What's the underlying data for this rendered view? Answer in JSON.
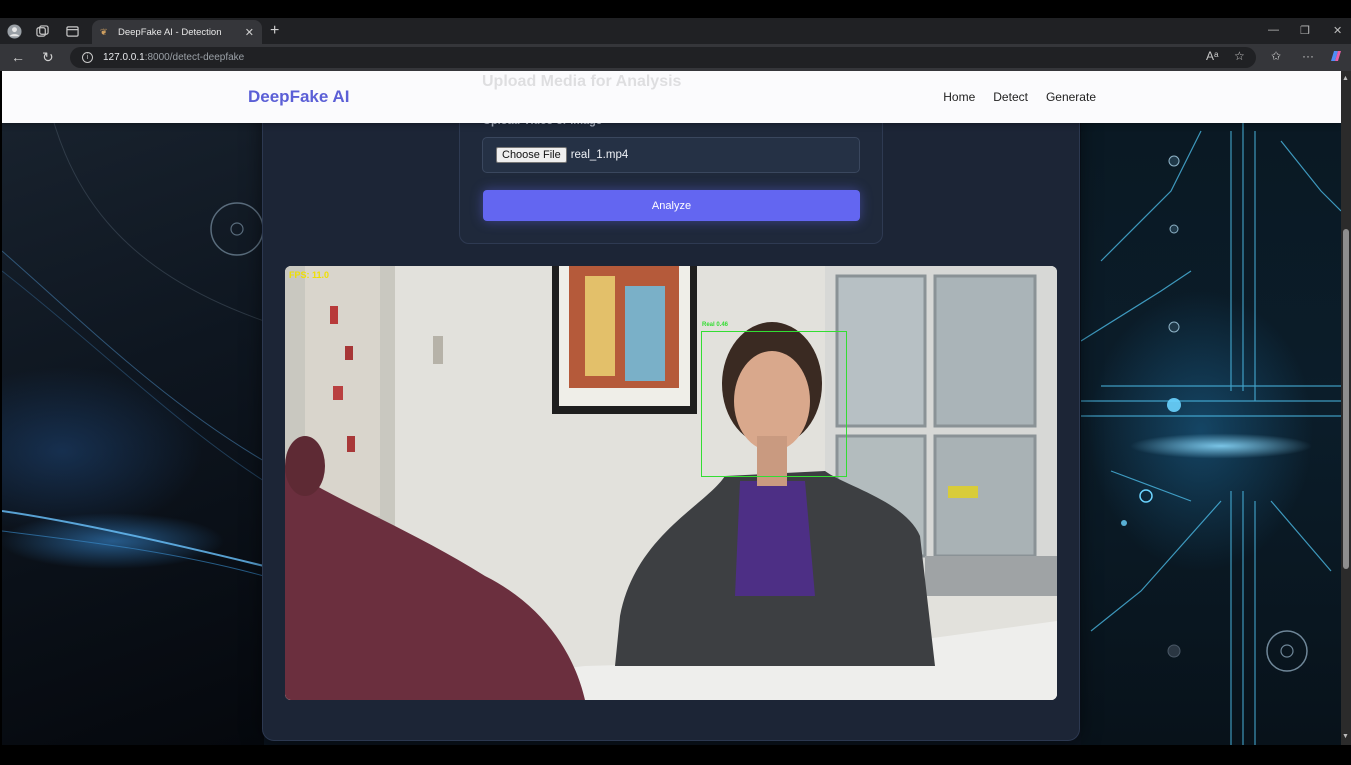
{
  "browser": {
    "tab_title": "DeepFake AI - Detection",
    "new_tab": "+",
    "url_host": "127.0.0.1",
    "url_rest": ":8000/detect-deepfake"
  },
  "navbar": {
    "brand": "DeepFake AI",
    "links": [
      "Home",
      "Detect",
      "Generate"
    ]
  },
  "form": {
    "section_title": "Upload Media for Analysis",
    "upload_label": "Upload Video or Image",
    "choose_file_label": "Choose File",
    "file_name": "real_1.mp4",
    "analyze_label": "Analyze"
  },
  "video": {
    "fps_text": "FPS: 11.0",
    "face_label": "Real 0.46",
    "box_color": "#33dd33"
  },
  "colors": {
    "accent": "#6366f1",
    "brand": "#5b5fd6"
  }
}
